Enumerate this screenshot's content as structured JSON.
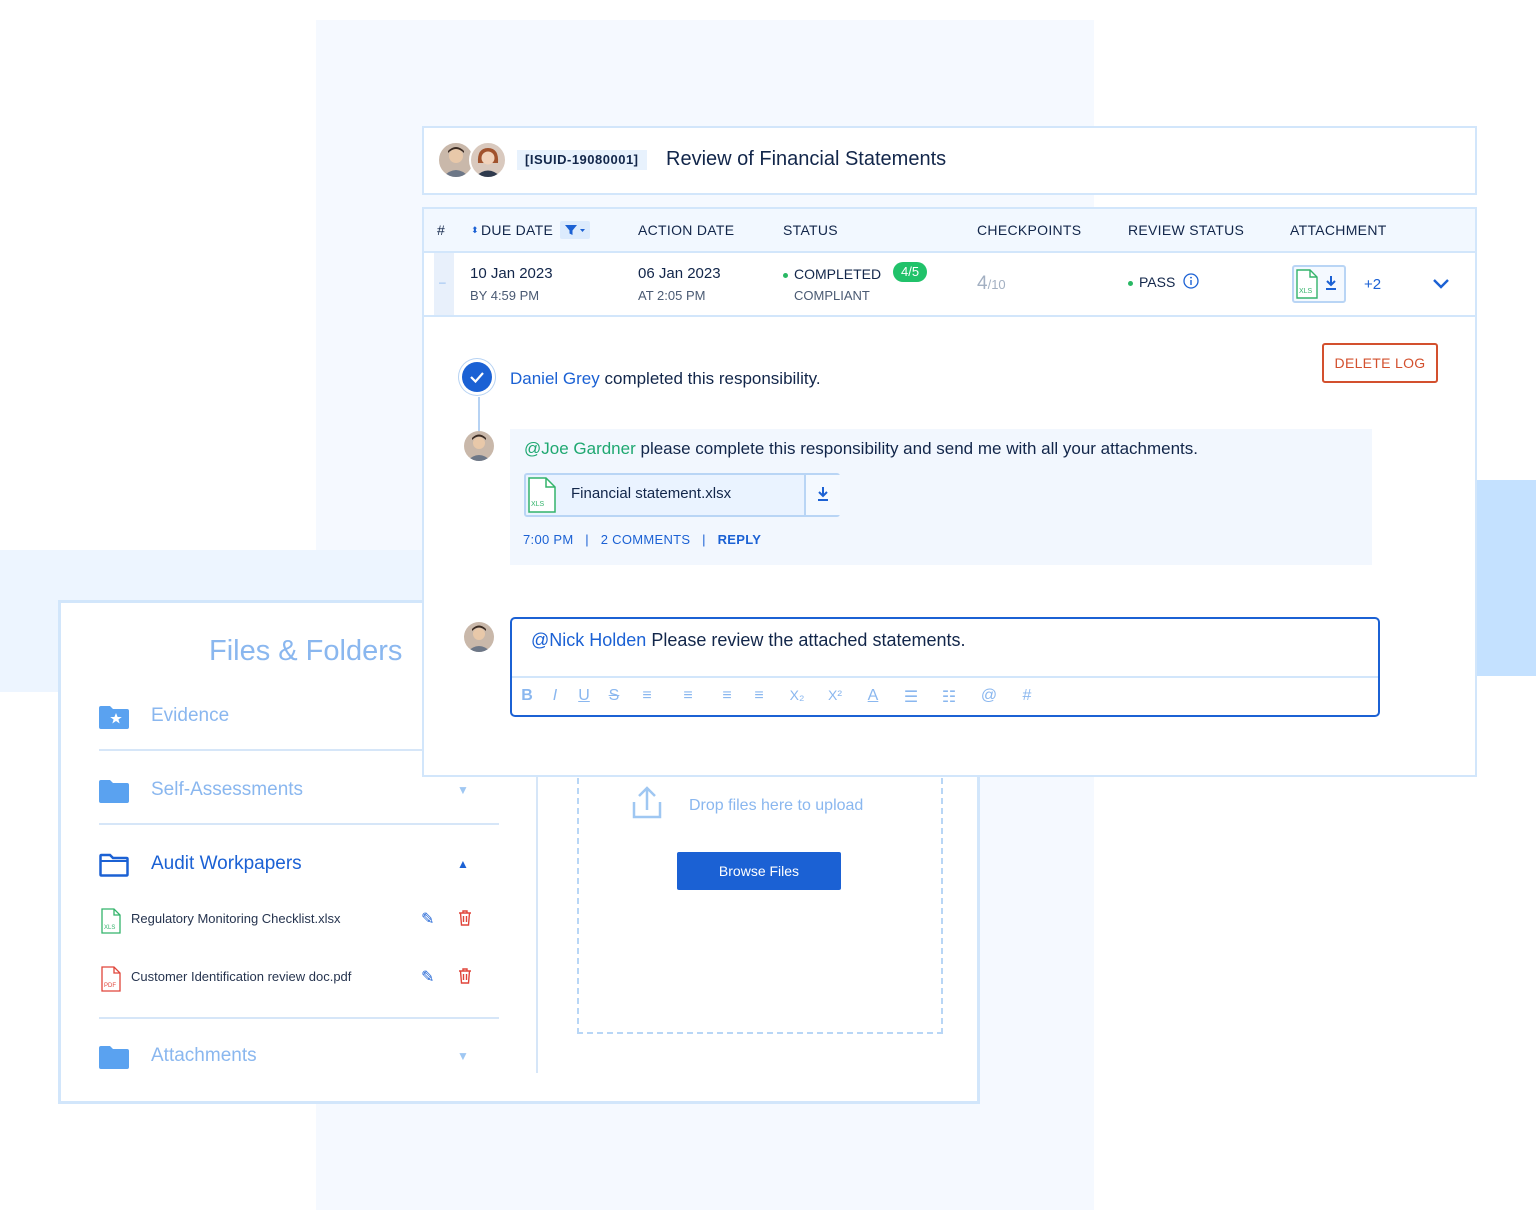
{
  "files_panel": {
    "title": "Files & Folders",
    "folders": [
      {
        "label": "Evidence",
        "icon": "folder-star-icon"
      },
      {
        "label": "Self-Assessments",
        "icon": "folder-icon"
      },
      {
        "label": "Audit Workpapers",
        "icon": "folder-open-icon",
        "expanded": true
      },
      {
        "label": "Attachments",
        "icon": "folder-icon"
      }
    ],
    "files": [
      {
        "name": "Regulatory Monitoring Checklist.xlsx",
        "type": "XLS"
      },
      {
        "name": "Customer Identification review doc.pdf",
        "type": "PDF"
      }
    ],
    "dropzone": {
      "text": "Drop files here to upload",
      "button": "Browse Files"
    }
  },
  "header": {
    "id": "[ISUID-19080001]",
    "title": "Review of Financial Statements"
  },
  "table": {
    "columns": [
      "#",
      "DUE DATE",
      "ACTION DATE",
      "STATUS",
      "CHECKPOINTS",
      "REVIEW STATUS",
      "ATTACHMENT"
    ],
    "row": {
      "due_date": "10 Jan 2023",
      "due_time": "BY 4:59 PM",
      "action_date": "06 Jan 2023",
      "action_time": "AT 2:05 PM",
      "status": "COMPLETED",
      "status_badge": "4/5",
      "status_sub": "COMPLIANT",
      "checkpoints_done": "4",
      "checkpoints_total": "/10",
      "review_status": "PASS",
      "attachment_type": "XLS",
      "attachment_more": "+2"
    }
  },
  "log": {
    "delete_label": "DELETE LOG",
    "entry_user": "Daniel Grey",
    "entry_text": " completed this responsibility."
  },
  "comment": {
    "mention": "@Joe Gardner",
    "text": " please complete this responsibility and send me with all your attachments.",
    "file_name": "Financial statement.xlsx",
    "file_type": "XLS",
    "time": "7:00 PM",
    "divider": "|",
    "comments": "2  COMMENTS",
    "reply": "REPLY"
  },
  "editor": {
    "mention": "@Nick Holden",
    "text": " Please review the attached statements.",
    "toolbar": [
      "B",
      "I",
      "U",
      "S",
      "≡",
      "≡",
      "≡",
      "≡",
      "X₂",
      "X²",
      "A",
      "☰",
      "☷",
      "@",
      "#"
    ]
  },
  "colors": {
    "primary": "#1b61d4",
    "mention": "#1fa871",
    "success": "#21c26a",
    "danger": "#d3502e",
    "muted": "#8ab7ef"
  }
}
